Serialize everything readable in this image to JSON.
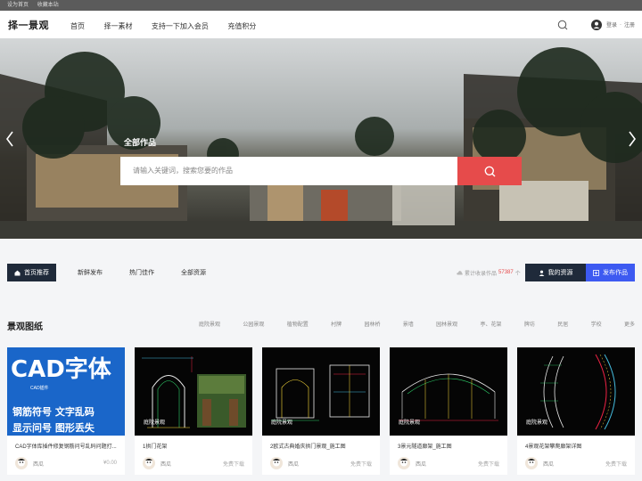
{
  "topbar": {
    "set_home": "设为首页",
    "bookmark": "收藏本站"
  },
  "header": {
    "logo": "择一景观",
    "nav": [
      "首页",
      "择一素材",
      "支持一下加入会员",
      "充值积分"
    ],
    "login": "登录",
    "sep": "·",
    "register": "注册",
    "icons": [
      "search-icon",
      "user-avatar-icon"
    ]
  },
  "hero": {
    "label": "全部作品",
    "search_placeholder": "请输入关键词，搜索您要的作品"
  },
  "tabs": {
    "items": [
      "首页推荐",
      "新鲜发布",
      "热门佳作",
      "全部资源"
    ],
    "stats_prefix": "累计收录作品",
    "stats_count": "57387",
    "stats_suffix": "个",
    "my_resources": "我的资源",
    "publish": "发布作品"
  },
  "section": {
    "title": "景观图纸",
    "categories": [
      "庭院景观",
      "公园景观",
      "植物配置",
      "村牌",
      "园林桥",
      "景墙",
      "园林景观",
      "亭、花架",
      "牌坊",
      "民居",
      "学校",
      "更多"
    ]
  },
  "cards": [
    {
      "title": "CAD字体库插件修复钢筋问号乱码问题打...",
      "tag": "",
      "author": "西瓜",
      "price": "¥0.00",
      "cad_title": "CAD字体",
      "cad_small": "CAD插件",
      "cad_l1": "钢筋符号  文字乱码",
      "cad_l2": "显示问号  图形丢失"
    },
    {
      "title": "1拱门花架",
      "tag": "庭院景观",
      "author": "西瓜",
      "price": "免费下载"
    },
    {
      "title": "2欧式古典婚庆拱门景观_施工图",
      "tag": "庭院景观",
      "author": "西瓜",
      "price": "免费下载"
    },
    {
      "title": "3景元隧道廊架_施工图",
      "tag": "庭院景观",
      "author": "西瓜",
      "price": "免费下载"
    },
    {
      "title": "4景观花架攀爬廊架详图",
      "tag": "庭院景观",
      "author": "西瓜",
      "price": "免费下载"
    }
  ],
  "colors": {
    "accent_red": "#e64b4b",
    "dark_navy": "#1f2a3a",
    "blue": "#3d5af1"
  }
}
